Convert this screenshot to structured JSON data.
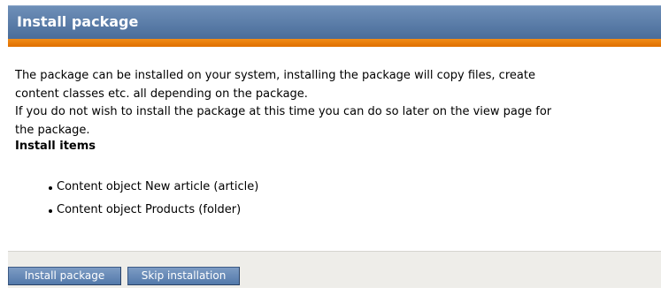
{
  "header": {
    "title": "Install package"
  },
  "content": {
    "intro_lines": [
      "The package can be installed on your system, installing the package will copy files, create",
      "content classes etc. all depending on the package.",
      "If you do not wish to install the package at this time you can do so later on the view page for",
      "the package."
    ],
    "items_heading": "Install items",
    "items": [
      "Content object New article (article)",
      "Content object Products (folder)"
    ]
  },
  "footer": {
    "install_label": "Install package",
    "skip_label": "Skip installation"
  },
  "colors": {
    "header_blue": "#5a7ca8",
    "accent_orange": "#e87d0d",
    "footer_gray": "#eeede9",
    "button_blue": "#6488b6"
  }
}
